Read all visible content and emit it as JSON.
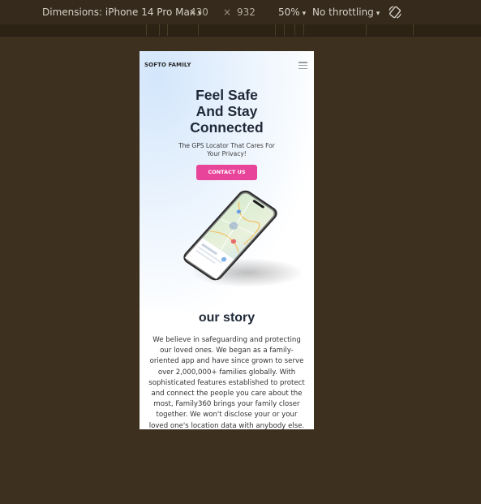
{
  "devtools": {
    "dimensions_label": "Dimensions: iPhone 14 Pro Max",
    "width": "430",
    "times": "×",
    "height": "932",
    "zoom": "50%",
    "throttling": "No throttling",
    "caret": "▾",
    "rotate_icon": "rotate-icon"
  },
  "page": {
    "brand": "SOFTO FAMILY",
    "menu_icon": "hamburger-icon",
    "headline": [
      "Feel Safe",
      "And Stay",
      "Connected"
    ],
    "subhead": "The GPS Locator That Cares For Your Privacy!",
    "cta_label": "CONTACT US",
    "story_title": "our story",
    "story_text": "We believe in safeguarding and protecting our loved ones. We began as a family-oriented app and have since grown to serve over 2,000,000+ families globally. With sophisticated features established to protect and connect the people you care about the most, Family360 brings your family closer together. We won't disclose your or your loved one's location data with anybody else."
  },
  "colors": {
    "cta": "#e8449a",
    "heading": "#1f2937",
    "devtools_bg": "#352a1c"
  }
}
